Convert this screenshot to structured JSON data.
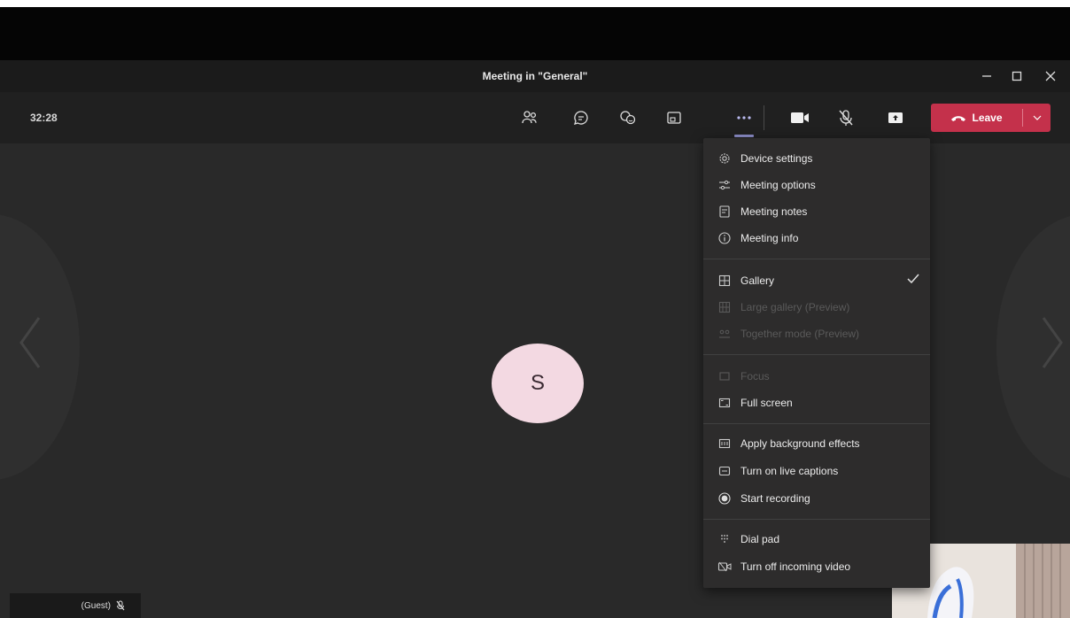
{
  "window": {
    "title": "Meeting in \"General\""
  },
  "toolbar": {
    "timer": "32:28",
    "leave_label": "Leave"
  },
  "stage": {
    "avatar_initial": "S",
    "guest_label": "(Guest)"
  },
  "menu": {
    "items": [
      {
        "label": "Device settings",
        "icon": "gear-icon",
        "enabled": true
      },
      {
        "label": "Meeting options",
        "icon": "sliders-icon",
        "enabled": true
      },
      {
        "label": "Meeting notes",
        "icon": "notes-icon",
        "enabled": true
      },
      {
        "label": "Meeting info",
        "icon": "info-icon",
        "enabled": true
      },
      {
        "label": "Gallery",
        "icon": "grid-icon",
        "enabled": true,
        "checked": true
      },
      {
        "label": "Large gallery (Preview)",
        "icon": "large-grid-icon",
        "enabled": false
      },
      {
        "label": "Together mode (Preview)",
        "icon": "together-icon",
        "enabled": false
      },
      {
        "label": "Focus",
        "icon": "focus-icon",
        "enabled": false
      },
      {
        "label": "Full screen",
        "icon": "fullscreen-icon",
        "enabled": true
      },
      {
        "label": "Apply background effects",
        "icon": "background-icon",
        "enabled": true
      },
      {
        "label": "Turn on live captions",
        "icon": "captions-icon",
        "enabled": true
      },
      {
        "label": "Start recording",
        "icon": "record-icon",
        "enabled": true
      },
      {
        "label": "Dial pad",
        "icon": "dialpad-icon",
        "enabled": true
      },
      {
        "label": "Turn off incoming video",
        "icon": "video-off-icon",
        "enabled": true
      }
    ]
  },
  "colors": {
    "leave_red": "#c4314b",
    "accent": "#8b8cc7",
    "avatar_bg": "#f3d9e2",
    "window_bg": "#292929"
  }
}
